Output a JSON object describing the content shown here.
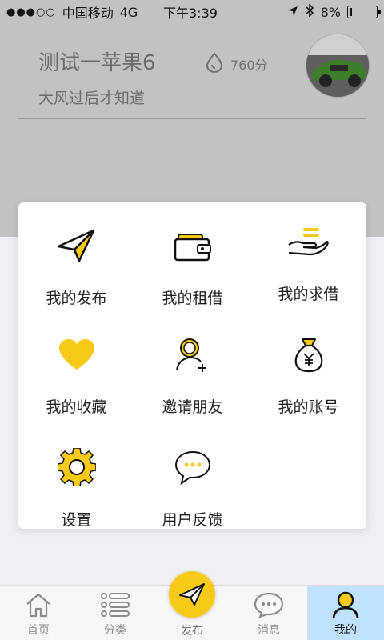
{
  "status_bar": {
    "signal": "●●●○○",
    "carrier": "中国移动",
    "network": "4G",
    "time": "下午3:39",
    "battery": "8%"
  },
  "profile": {
    "username": "测试一苹果6",
    "score": "760分",
    "signature": "大风过后才知道"
  },
  "menu": {
    "items": [
      {
        "label": "我的发布",
        "icon": "paper-plane-icon"
      },
      {
        "label": "我的租借",
        "icon": "wallet-icon"
      },
      {
        "label": "我的求借",
        "icon": "hand-coins-icon"
      },
      {
        "label": "我的收藏",
        "icon": "heart-icon"
      },
      {
        "label": "邀请朋友",
        "icon": "add-friend-icon"
      },
      {
        "label": "我的账号",
        "icon": "money-bag-icon"
      },
      {
        "label": "设置",
        "icon": "gear-icon"
      },
      {
        "label": "用户反馈",
        "icon": "chat-bubble-icon"
      }
    ]
  },
  "tabbar": {
    "home": "首页",
    "category": "分类",
    "publish": "发布",
    "messages": "消息",
    "mine": "我的"
  },
  "colors": {
    "accent": "#f7ca18",
    "header_bg": "#c2c2c2",
    "active_tab_bg": "#bfe3ff"
  }
}
